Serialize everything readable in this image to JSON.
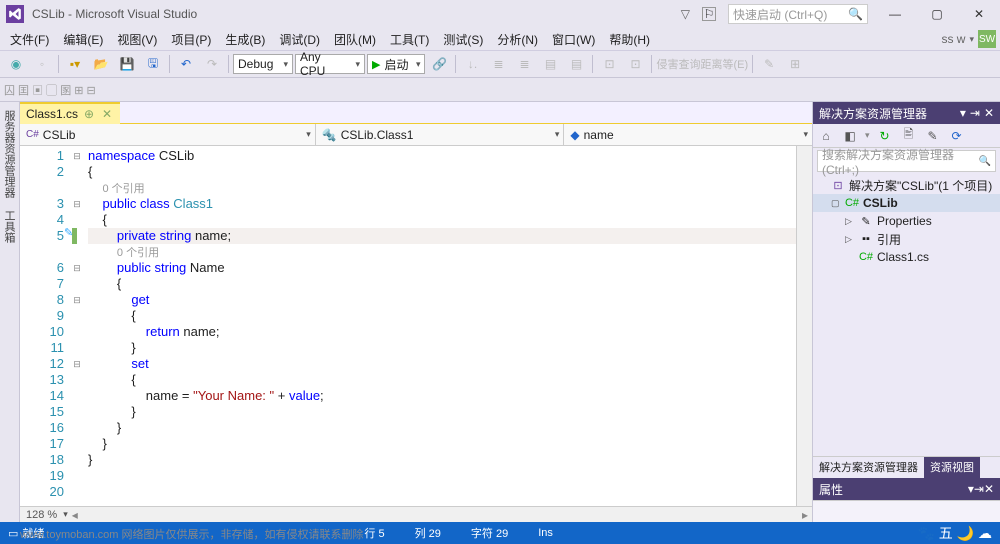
{
  "titlebar": {
    "title": "CSLib - Microsoft Visual Studio",
    "search_placeholder": "快速启动 (Ctrl+Q)"
  },
  "menubar": {
    "items": [
      "文件(F)",
      "编辑(E)",
      "视图(V)",
      "项目(P)",
      "生成(B)",
      "调试(D)",
      "团队(M)",
      "工具(T)",
      "测试(S)",
      "分析(N)",
      "窗口(W)",
      "帮助(H)"
    ],
    "user": "ss w"
  },
  "toolbar": {
    "config": "Debug",
    "platform": "Any CPU",
    "start_label": "启动",
    "text_end": "侵害查询距离等(E)"
  },
  "toolbar2": {
    "symbols": "囚 囯 ▣ ▢ 圂 ⊞ ⊟"
  },
  "filetab": {
    "name": "Class1.cs"
  },
  "navbar": {
    "project": "CSLib",
    "class": "CSLib.Class1",
    "member": "name"
  },
  "code": {
    "lines": [
      {
        "n": 1,
        "fold": "-",
        "html": "<span class='kw'>namespace</span> CSLib"
      },
      {
        "n": 2,
        "html": "{"
      },
      {
        "n": "",
        "html": "    <span class='codelens'>0 个引用</span>"
      },
      {
        "n": 3,
        "fold": "-",
        "html": "    <span class='kw'>public</span> <span class='kw'>class</span> <span class='type'>Class1</span>"
      },
      {
        "n": 4,
        "html": "    {"
      },
      {
        "n": 5,
        "active": true,
        "edit": true,
        "html": "        <span class='kw'>private</span> <span class='kw'>string</span> name;"
      },
      {
        "n": "",
        "html": "        <span class='codelens'>0 个引用</span>"
      },
      {
        "n": 6,
        "fold": "-",
        "html": "        <span class='kw'>public</span> <span class='kw'>string</span> Name"
      },
      {
        "n": 7,
        "html": "        {"
      },
      {
        "n": 8,
        "fold": "-",
        "html": "            <span class='kw'>get</span>"
      },
      {
        "n": 9,
        "html": "            {"
      },
      {
        "n": 10,
        "html": "                <span class='kw'>return</span> name;"
      },
      {
        "n": 11,
        "html": "            }"
      },
      {
        "n": 12,
        "fold": "-",
        "html": "            <span class='kw'>set</span>"
      },
      {
        "n": 13,
        "html": "            {"
      },
      {
        "n": 14,
        "html": "                name = <span class='str'>\"Your Name: \"</span> + <span class='kw'>value</span>;"
      },
      {
        "n": 15,
        "html": "            }"
      },
      {
        "n": 16,
        "html": "        }"
      },
      {
        "n": 17,
        "html": "    }"
      },
      {
        "n": 18,
        "html": "}"
      },
      {
        "n": 19,
        "html": ""
      },
      {
        "n": 20,
        "html": ""
      }
    ],
    "zoom": "128 %"
  },
  "solution": {
    "title": "解决方案资源管理器",
    "search_placeholder": "搜索解决方案资源管理器(Ctrl+;)",
    "root": "解决方案\"CSLib\"(1 个项目)",
    "project": "CSLib",
    "nodes": [
      "Properties",
      "引用",
      "Class1.cs"
    ],
    "tabs": [
      "解决方案资源管理器",
      "资源视图"
    ]
  },
  "properties": {
    "title": "属性"
  },
  "statusbar": {
    "ready": "就绪",
    "line": "行 5",
    "col": "列 29",
    "ch": "字符 29",
    "ins": "Ins"
  },
  "watermark": "www.toymoban.com 网络图片仅供展示，非存储，如有侵权请联系删除"
}
